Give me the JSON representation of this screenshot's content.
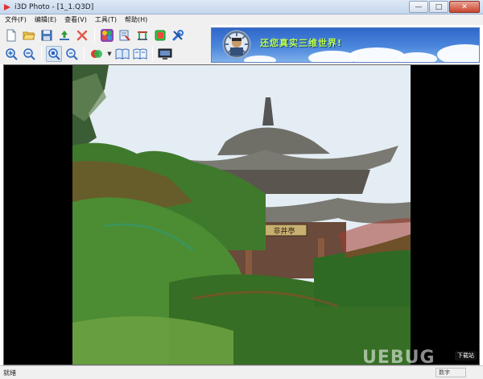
{
  "window": {
    "title": "i3D Photo - [1_1.Q3D]"
  },
  "window_controls": {
    "minimize": "—",
    "maximize": "□",
    "close": "✕"
  },
  "menu": {
    "items": [
      "文件(F)",
      "编辑(E)",
      "查看(V)",
      "工具(T)",
      "帮助(H)"
    ]
  },
  "toolbar": {
    "row1": [
      "new-file",
      "open-folder",
      "save",
      "export",
      "delete",
      "color-palette",
      "stereo-editor",
      "align-tool",
      "green-cube",
      "tools-wrench"
    ],
    "row2": [
      "zoom-in",
      "zoom-out",
      "zoom-fit",
      "zoom-actual",
      "stereo-mode",
      "book-open",
      "book-open-alt",
      "display-monitor"
    ]
  },
  "banner": {
    "text": "还您真实三维世界!"
  },
  "photo": {
    "signboard": "非井亭"
  },
  "status": {
    "text": "就绪",
    "mode": "数字"
  },
  "watermark": {
    "text": "UEBUG",
    "badge": "下载站"
  },
  "colors": {
    "title_bg": "#c5d6ec",
    "banner_blue": "#2f67c9",
    "banner_text": "#bfff4d"
  }
}
